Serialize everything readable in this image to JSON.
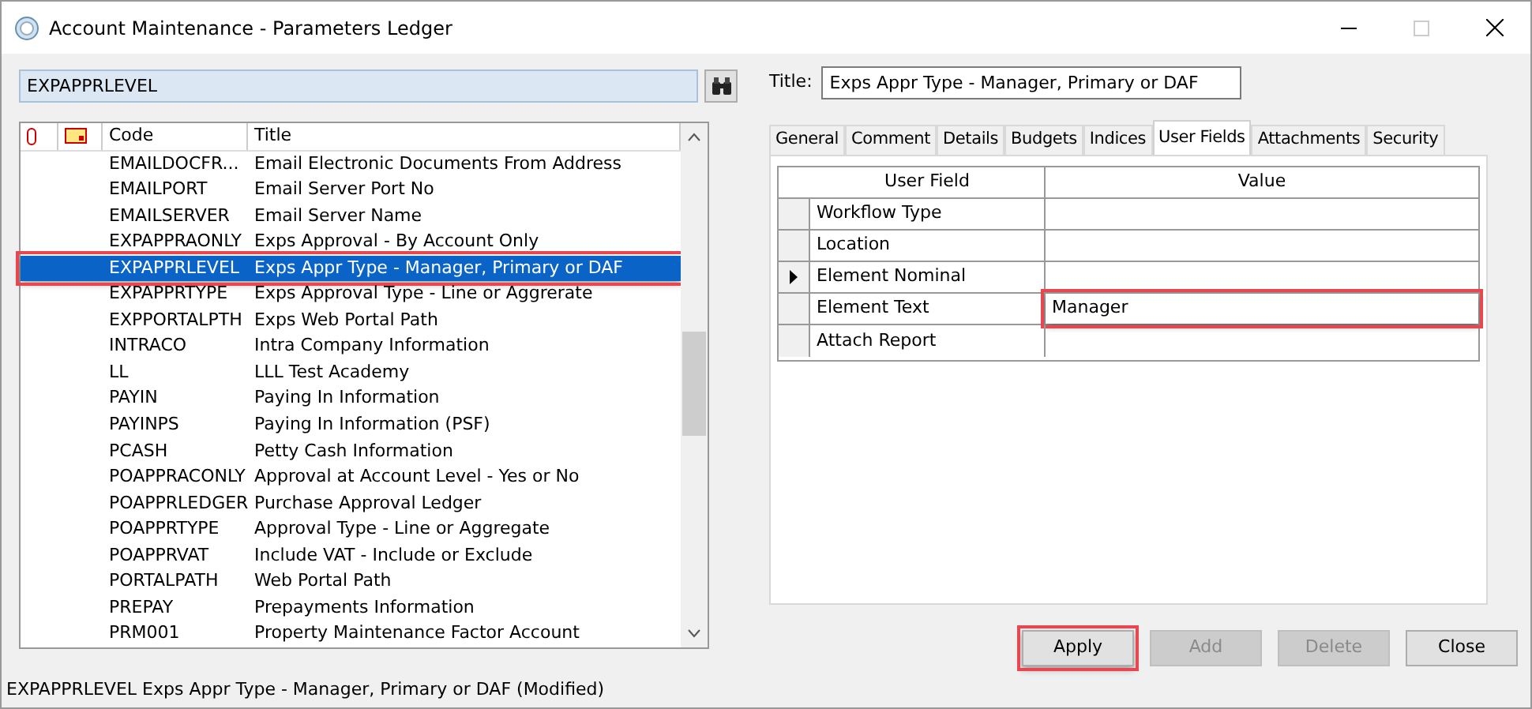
{
  "window": {
    "title": "Account Maintenance - Parameters Ledger"
  },
  "search": {
    "value": "EXPAPPRLEVEL"
  },
  "list": {
    "columns": [
      "Code",
      "Title"
    ],
    "rows": [
      {
        "code": "EMAILDOCFR...",
        "title": "Email Electronic Documents From Address",
        "selected": false,
        "annotated": false
      },
      {
        "code": "EMAILPORT",
        "title": "Email Server Port No",
        "selected": false,
        "annotated": false
      },
      {
        "code": "EMAILSERVER",
        "title": "Email Server Name",
        "selected": false,
        "annotated": false
      },
      {
        "code": "EXPAPPRAONLY",
        "title": "Exps Approval - By Account Only",
        "selected": false,
        "annotated": false
      },
      {
        "code": "EXPAPPRLEVEL",
        "title": "Exps Appr Type - Manager, Primary or DAF",
        "selected": true,
        "annotated": true
      },
      {
        "code": "EXPAPPRTYPE",
        "title": "Exps Approval Type - Line or Aggrerate",
        "selected": false,
        "annotated": false
      },
      {
        "code": "EXPPORTALPTH",
        "title": "Exps Web Portal Path",
        "selected": false,
        "annotated": false
      },
      {
        "code": "INTRACO",
        "title": "Intra Company Information",
        "selected": false,
        "annotated": false
      },
      {
        "code": "LL",
        "title": "LLL Test Academy",
        "selected": false,
        "annotated": false
      },
      {
        "code": "PAYIN",
        "title": "Paying In Information",
        "selected": false,
        "annotated": false
      },
      {
        "code": "PAYINPS",
        "title": "Paying In Information (PSF)",
        "selected": false,
        "annotated": false
      },
      {
        "code": "PCASH",
        "title": "Petty Cash Information",
        "selected": false,
        "annotated": false
      },
      {
        "code": "POAPPRACONLY",
        "title": "Approval at Account Level -  Yes or No",
        "selected": false,
        "annotated": false
      },
      {
        "code": "POAPPRLEDGER",
        "title": "Purchase Approval Ledger",
        "selected": false,
        "annotated": false
      },
      {
        "code": "POAPPRTYPE",
        "title": "Approval Type - Line or Aggregate",
        "selected": false,
        "annotated": false
      },
      {
        "code": "POAPPRVAT",
        "title": "Include VAT - Include or Exclude",
        "selected": false,
        "annotated": false
      },
      {
        "code": "PORTALPATH",
        "title": "Web Portal Path",
        "selected": false,
        "annotated": false
      },
      {
        "code": "PREPAY",
        "title": "Prepayments Information",
        "selected": false,
        "annotated": false
      },
      {
        "code": "PRM001",
        "title": "Property Maintenance Factor Account",
        "selected": false,
        "annotated": false
      }
    ]
  },
  "status_bar": "EXPAPPRLEVEL Exps Appr Type - Manager, Primary or DAF (Modified)",
  "title_field": {
    "label": "Title:",
    "value": "Exps Appr Type - Manager, Primary or DAF"
  },
  "tabs": [
    {
      "label": "General",
      "selected": false
    },
    {
      "label": "Comment",
      "selected": false
    },
    {
      "label": "Details",
      "selected": false
    },
    {
      "label": "Budgets",
      "selected": false
    },
    {
      "label": "Indices",
      "selected": false
    },
    {
      "label": "User Fields",
      "selected": true
    },
    {
      "label": "Attachments",
      "selected": false
    },
    {
      "label": "Security",
      "selected": false
    }
  ],
  "grid": {
    "columns": [
      "User Field",
      "Value"
    ],
    "rows": [
      {
        "field": "Workflow Type",
        "value": "",
        "current": false,
        "annotated": false
      },
      {
        "field": "Location",
        "value": "",
        "current": false,
        "annotated": false
      },
      {
        "field": "Element Nominal",
        "value": "",
        "current": true,
        "annotated": false
      },
      {
        "field": "Element Text",
        "value": "Manager",
        "current": false,
        "annotated": true
      },
      {
        "field": "Attach Report",
        "value": "",
        "current": false,
        "annotated": false
      }
    ]
  },
  "buttons": [
    {
      "label": "Apply",
      "disabled": false,
      "annotated": true
    },
    {
      "label": "Add",
      "disabled": true,
      "annotated": false
    },
    {
      "label": "Delete",
      "disabled": true,
      "annotated": false
    },
    {
      "label": "Close",
      "disabled": false,
      "annotated": false
    }
  ]
}
